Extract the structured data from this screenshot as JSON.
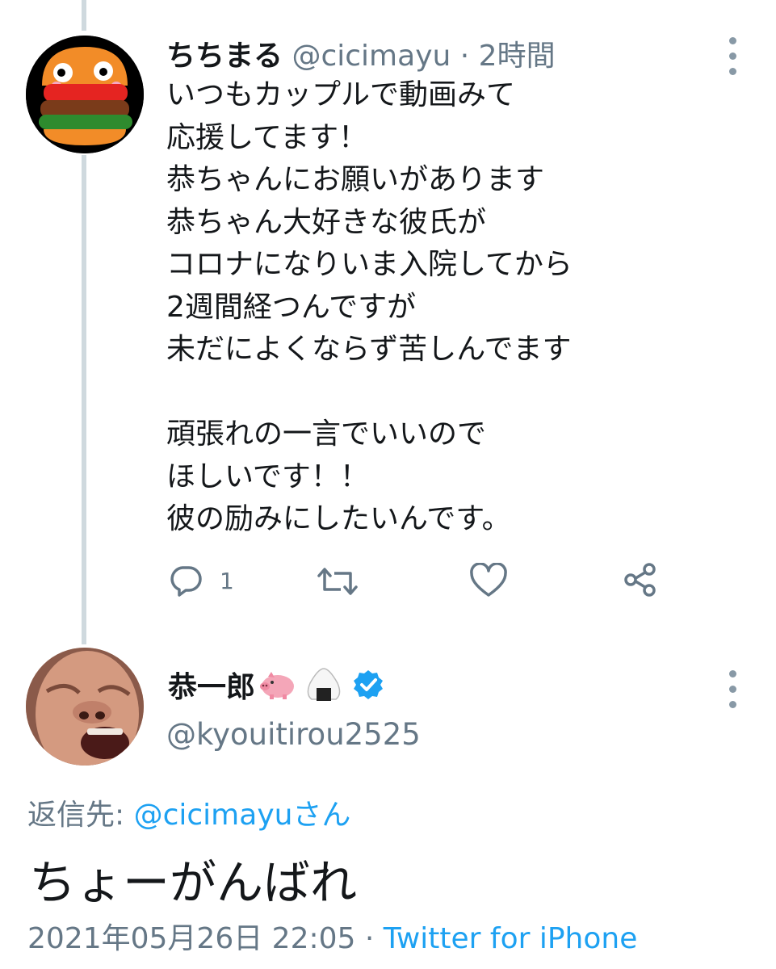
{
  "reply_tweet": {
    "display_name": "ちちまる",
    "handle": "@cicimayu",
    "separator": "·",
    "time_ago": "2時間",
    "text": "いつもカップルで動画みて\n応援してます！\n恭ちゃんにお願いがあります\n恭ちゃん大好きな彼氏が\nコロナになりいま入院してから\n2週間経つんですが\n未だによくならず苦しんでます\n\n頑張れの一言でいいので\nほしいです！！\n彼の励みにしたいんです。",
    "reply_count": "1",
    "avatar_icon": "hamburger-avatar",
    "colors": {
      "text": "#14171a",
      "meta": "#657786"
    }
  },
  "main_tweet": {
    "display_name": "恭一郎",
    "name_emojis": [
      "pig-icon",
      "onigiri-icon"
    ],
    "verified_icon": "verified-badge-icon",
    "handle": "@kyouitirou2525",
    "reply_label": "返信先:",
    "reply_to": "@cicimayuさん",
    "text": "ちょーがんばれ",
    "date": "2021年05月26日 22:05",
    "separator": "·",
    "source": "Twitter for iPhone",
    "colors": {
      "link": "#1da1f2",
      "verified": "#1da1f2"
    }
  }
}
